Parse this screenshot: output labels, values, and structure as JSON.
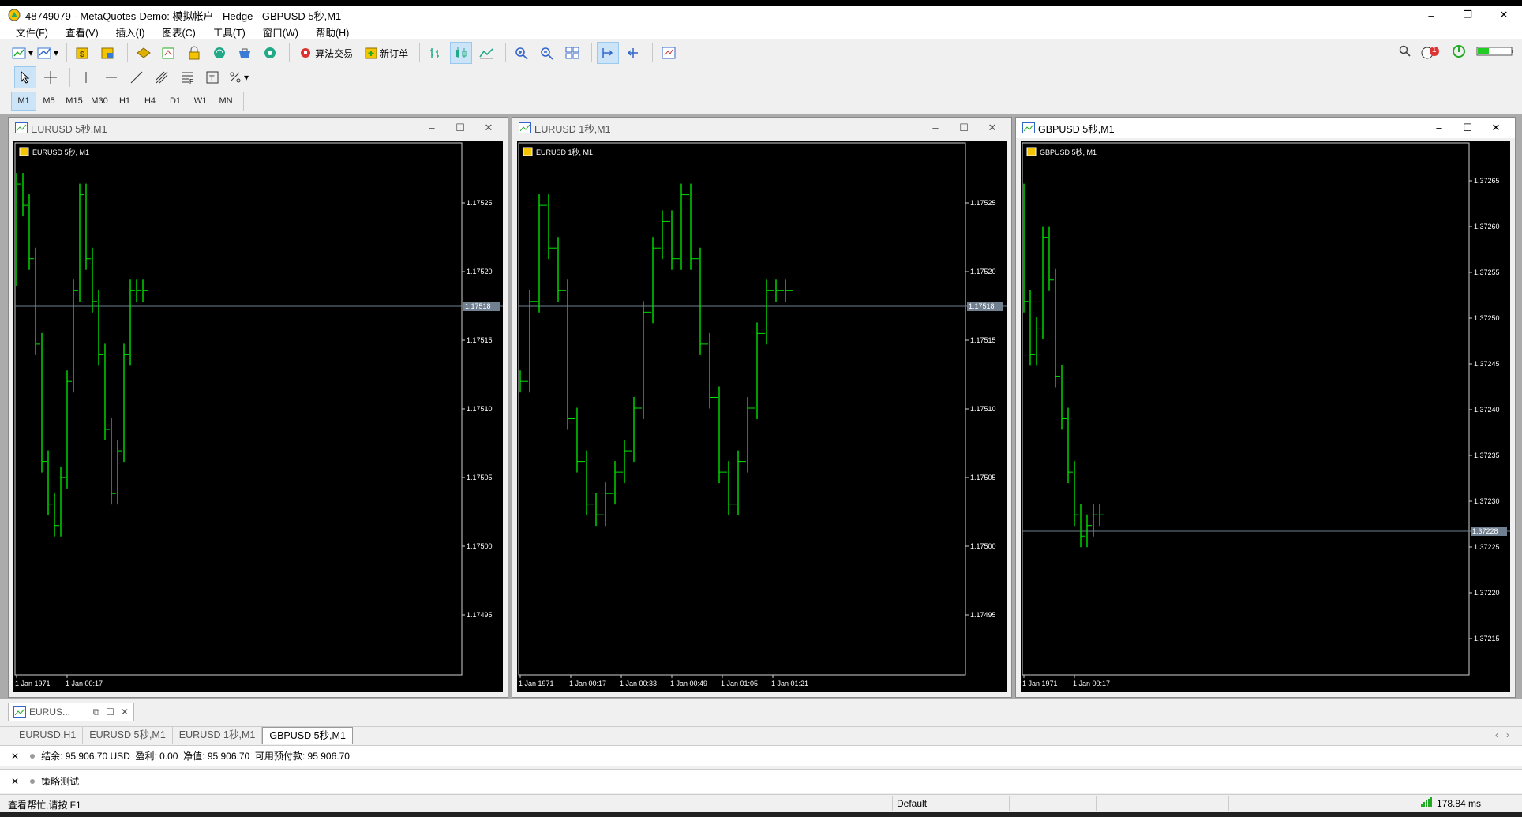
{
  "window": {
    "title": "48749079 - MetaQuotes-Demo: 模拟帐户 - Hedge - GBPUSD 5秒,M1",
    "controls": [
      "–",
      "❐",
      "✕"
    ]
  },
  "menu": [
    "文件(F)",
    "查看(V)",
    "插入(I)",
    "图表(C)",
    "工具(T)",
    "窗口(W)",
    "帮助(H)"
  ],
  "toolbar": {
    "algo_label": "算法交易",
    "new_order_label": "新订单",
    "notif_count": "1"
  },
  "timeframes": [
    "M1",
    "M5",
    "M15",
    "M30",
    "H1",
    "H4",
    "D1",
    "W1",
    "MN"
  ],
  "selected_timeframe": "M1",
  "charts": [
    {
      "window_title": "EURUSD 5秒,M1",
      "inner_label": "EURUSD 5秒, M1",
      "price_tag": "1.17518",
      "y_ticks": [
        "1.17525",
        "1.17520",
        "1.17515",
        "1.17510",
        "1.17505",
        "1.17500",
        "1.17495"
      ],
      "x_ticks": [
        "1 Jan 1971",
        "1 Jan 00:17"
      ],
      "active": false
    },
    {
      "window_title": "EURUSD 1秒,M1",
      "inner_label": "EURUSD 1秒, M1",
      "price_tag": "1.17518",
      "y_ticks": [
        "1.17525",
        "1.17520",
        "1.17515",
        "1.17510",
        "1.17505",
        "1.17500",
        "1.17495"
      ],
      "x_ticks": [
        "1 Jan 1971",
        "1 Jan 00:17",
        "1 Jan 00:33",
        "1 Jan 00:49",
        "1 Jan 01:05",
        "1 Jan 01:21"
      ],
      "active": false
    },
    {
      "window_title": "GBPUSD 5秒,M1",
      "inner_label": "GBPUSD 5秒, M1",
      "price_tag": "1.37228",
      "y_ticks": [
        "1.37265",
        "1.37260",
        "1.37255",
        "1.37250",
        "1.37245",
        "1.37240",
        "1.37235",
        "1.37230",
        "1.37225",
        "1.37220",
        "1.37215"
      ],
      "x_ticks": [
        "1 Jan 1971",
        "1 Jan 00:17"
      ],
      "active": true
    }
  ],
  "minimized_window": "EURUS...",
  "tabs": [
    "EURUSD,H1",
    "EURUSD 5秒,M1",
    "EURUSD 1秒,M1",
    "GBPUSD 5秒,M1"
  ],
  "selected_tab": "GBPUSD 5秒,M1",
  "account": "结余: 95 906.70 USD  盈利: 0.00  净值: 95 906.70  可用预付款: 95 906.70",
  "strategy": "策略测试",
  "status": {
    "help": "查看帮忙,请按 F1",
    "profile": "Default",
    "ping": "178.84 ms"
  },
  "colors": {
    "candle": "#00e000",
    "chart_bg": "#000000",
    "price_line": "#708090"
  }
}
